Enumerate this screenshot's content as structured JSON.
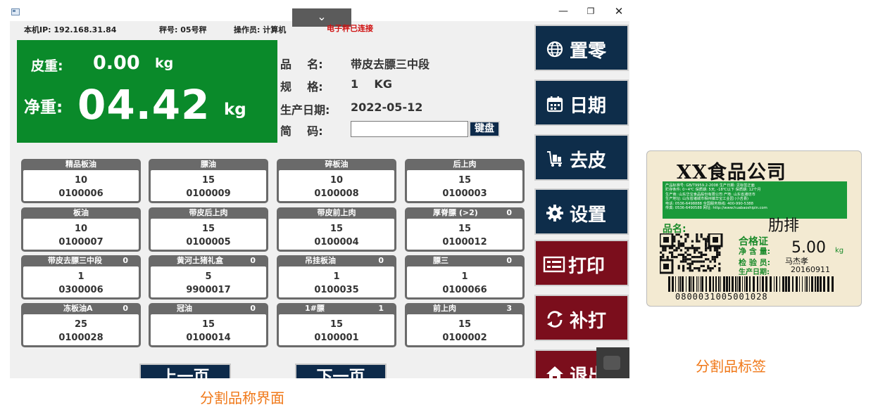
{
  "window": {
    "dropdown_glyph": "⌄",
    "min_glyph": "—",
    "max_glyph": "❐",
    "close_glyph": "✕"
  },
  "infobar": {
    "ip": "本机IP: 192.168.31.84",
    "scale": "秤号: 05号秤",
    "operator": "操作员: 计算机",
    "status": "电子秤已连接"
  },
  "weight": {
    "tare_label": "皮重:",
    "tare_value": "0.00",
    "tare_unit": "kg",
    "net_label": "净重:",
    "net_value": "04.42",
    "net_unit": "kg"
  },
  "product": {
    "name_key": "品    名:",
    "name_value": "带皮去膘三中段",
    "spec_key": "规    格:",
    "spec_value": "1    KG",
    "date_key": "生产日期:",
    "date_value": "2022-05-12",
    "code_key": "简    码:",
    "code_value": "",
    "keyboard_label": "键盘"
  },
  "grid": [
    {
      "name": "精品板油",
      "count": "",
      "qty": "10",
      "code": "0100006"
    },
    {
      "name": "膘油",
      "count": "",
      "qty": "15",
      "code": "0100009"
    },
    {
      "name": "碎板油",
      "count": "",
      "qty": "10",
      "code": "0100008"
    },
    {
      "name": "后上肉",
      "count": "",
      "qty": "15",
      "code": "0100003"
    },
    {
      "name": "板油",
      "count": "",
      "qty": "10",
      "code": "0100007"
    },
    {
      "name": "带皮后上肉",
      "count": "",
      "qty": "15",
      "code": "0100005"
    },
    {
      "name": "带皮前上肉",
      "count": "",
      "qty": "15",
      "code": "0100004"
    },
    {
      "name": "厚脊膘 (>2)",
      "count": "0",
      "qty": "15",
      "code": "0100012"
    },
    {
      "name": "带皮去膘三中段",
      "count": "0",
      "qty": "1",
      "code": "0300006"
    },
    {
      "name": "黄河土猪礼盒",
      "count": "0",
      "qty": "5",
      "code": "9900017"
    },
    {
      "name": "吊挂板油",
      "count": "0",
      "qty": "1",
      "code": "0100035"
    },
    {
      "name": "膘三",
      "count": "0",
      "qty": "1",
      "code": "0100066"
    },
    {
      "name": "冻板油A",
      "count": "0",
      "qty": "25",
      "code": "0100028"
    },
    {
      "name": "冠油",
      "count": "0",
      "qty": "15",
      "code": "0100014"
    },
    {
      "name": "1#膘",
      "count": "1",
      "qty": "15",
      "code": "0100001"
    },
    {
      "name": "前上肉",
      "count": "3",
      "qty": "15",
      "code": "0100002"
    }
  ],
  "paging": {
    "prev": "上一页",
    "next": "下一页"
  },
  "actions": {
    "zero": "置零",
    "date": "日期",
    "tare": "去皮",
    "settings": "设置",
    "print": "打印",
    "reprint": "补打",
    "exit": "退出"
  },
  "captions": {
    "ui": "分割品称界面",
    "label": "分割品标签"
  },
  "label": {
    "company": "XX食品公司",
    "green_lines": [
      "产品标准号: GB/T9959.2-2008      生产日期: 见标签正面",
      "贮存条件: 0~4℃ 保质期: 5天, -18℃以下 保质期: 12个月",
      "生产商: 山东华宝食品股份有限公司   产地: 山东省潍坊市",
      "生产地址: 山东省诸城市相州镇华宝工业园 (小吉县)",
      "电话: 0536-6498888   全国服务热线: 400-990-5388",
      "传真: 0536-6490588   网址: http://www.huabaoshipin.com"
    ],
    "name_key": "品名:",
    "name_value": "肋排",
    "cert": "合格证",
    "weight_key": "净 含 量:",
    "weight_value": "5.00",
    "weight_unit": "kg",
    "inspector_key": "检 验 员:",
    "inspector_value": "马杰孝",
    "proddate_key": "生产日期:",
    "proddate_value": "20160911",
    "barcode_number": "0800031005001028"
  },
  "colors": {
    "weight_panel": "#0a8a2a",
    "navy_button": "#0e2d4a",
    "maroon_button": "#7b0e1c",
    "status_text": "#d01010",
    "caption": "#f07818"
  }
}
